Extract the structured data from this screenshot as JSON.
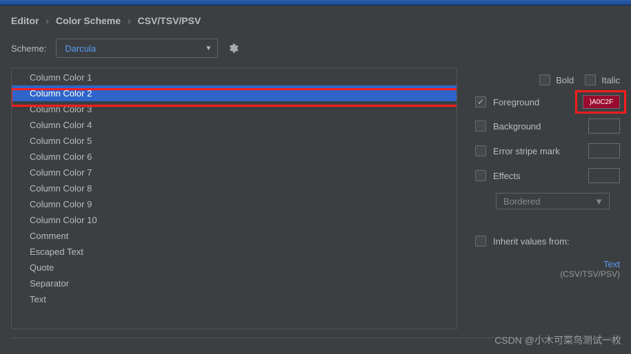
{
  "breadcrumb": {
    "a": "Editor",
    "b": "Color Scheme",
    "c": "CSV/TSV/PSV"
  },
  "scheme": {
    "label": "Scheme:",
    "value": "Darcula"
  },
  "listItems": [
    {
      "label": "Column Color 1"
    },
    {
      "label": "Column Color 2"
    },
    {
      "label": "Column Color 3"
    },
    {
      "label": "Column Color 4"
    },
    {
      "label": "Column Color 5"
    },
    {
      "label": "Column Color 6"
    },
    {
      "label": "Column Color 7"
    },
    {
      "label": "Column Color 8"
    },
    {
      "label": "Column Color 9"
    },
    {
      "label": "Column Color 10"
    },
    {
      "label": "Comment"
    },
    {
      "label": "Escaped Text"
    },
    {
      "label": "Quote"
    },
    {
      "label": "Separator"
    },
    {
      "label": "Text"
    }
  ],
  "selectedIndex": 1,
  "props": {
    "bold": "Bold",
    "italic": "Italic",
    "foreground": "Foreground",
    "foregroundHex": ")A0C2F",
    "background": "Background",
    "errorStripe": "Error stripe mark",
    "effects": "Effects",
    "effectsValue": "Bordered",
    "inherit": "Inherit values from:",
    "inheritLink": "Text",
    "inheritSub": "(CSV/TSV/PSV)"
  },
  "watermark": "CSDN @小木可菜鸟测试一枚"
}
